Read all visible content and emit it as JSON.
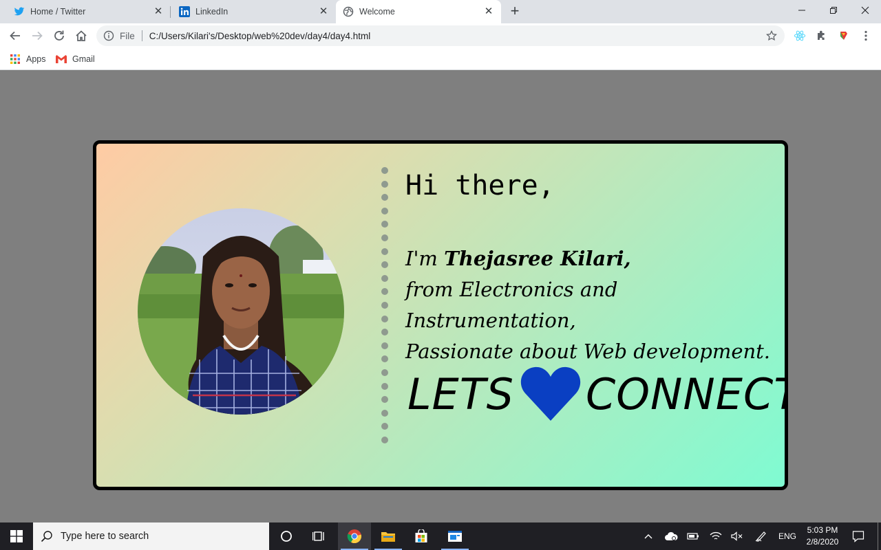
{
  "browser": {
    "tabs": [
      {
        "label": "Home / Twitter",
        "icon": "twitter-icon"
      },
      {
        "label": "LinkedIn",
        "icon": "linkedin-icon"
      },
      {
        "label": "Welcome",
        "icon": "globe-icon",
        "active": true
      }
    ],
    "address": {
      "scheme_label": "File",
      "url": "C:/Users/Kilari's/Desktop/web%20dev/day4/day4.html"
    },
    "bookmarks": [
      {
        "label": "Apps",
        "icon": "apps-grid-icon"
      },
      {
        "label": "Gmail",
        "icon": "gmail-icon"
      }
    ]
  },
  "page": {
    "greeting": "Hi there,",
    "intro_prefix": "I'm ",
    "intro_name": "Thejasree Kilari,",
    "intro_line2": "from Electronics and Instrumentation,",
    "intro_line3": "Passionate about Web development.",
    "connect_left": "LETS",
    "connect_right": "CONNECT",
    "heart_color": "#0a3fc2"
  },
  "taskbar": {
    "search_placeholder": "Type here to search",
    "language": "ENG",
    "time": "5:03 PM",
    "date": "2/8/2020"
  },
  "colors": {
    "page_background": "#7f7f7f",
    "gradient_start": "#ffcba4",
    "gradient_end": "#7ffbd2",
    "card_border": "#000000"
  }
}
